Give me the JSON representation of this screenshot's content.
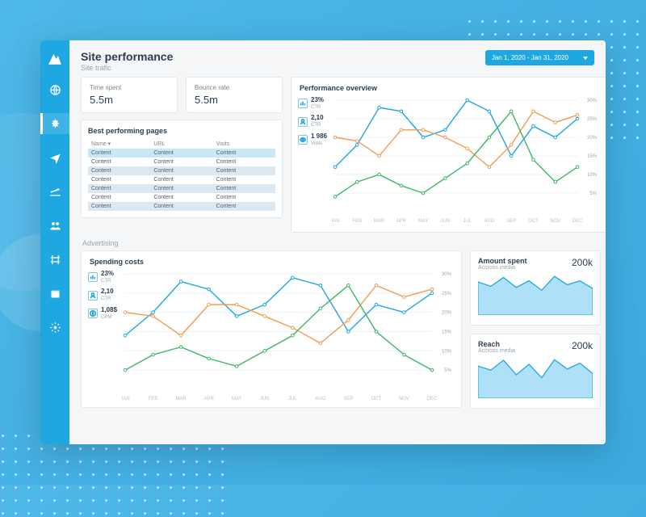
{
  "header": {
    "title": "Site performance",
    "subtitle": "Site trafic",
    "date_range": "Jan 1, 2020 - Jan 31, 2020"
  },
  "kpi": {
    "time_spent_label": "Time spent",
    "time_spent": "5.5m",
    "bounce_label": "Bounce rate",
    "bounce": "5.5m"
  },
  "table": {
    "title": "Best performing pages",
    "cols": {
      "c0": "Name ▾",
      "c1": "URL",
      "c2": "Visits"
    },
    "cell": "Content"
  },
  "overview": {
    "title": "Performance overview",
    "stats": {
      "s0v": "23%",
      "s0l": "CTR",
      "s1v": "2,10",
      "s1l": "CTR",
      "s2v": "1 986",
      "s2l": "Visits"
    }
  },
  "advertising_label": "Advertising",
  "spending": {
    "title": "Spending costs",
    "stats": {
      "s0v": "23%",
      "s0l": "CTR",
      "s1v": "2,10",
      "s1l": "CTR",
      "s2v": "1,08$",
      "s2l": "CPM"
    }
  },
  "amount": {
    "title": "Amount spent",
    "sub": "Accross media",
    "value": "200k"
  },
  "reach": {
    "title": "Reach",
    "sub": "Accross media",
    "value": "200k"
  },
  "chart_data": [
    {
      "type": "line",
      "title": "Performance overview",
      "xlabel": "",
      "ylabel": "",
      "ylim": [
        0,
        30
      ],
      "categories": [
        "JAN",
        "FEB",
        "MAR",
        "APR",
        "MAY",
        "JUN",
        "JUL",
        "AUG",
        "SEP",
        "OCT",
        "NOV",
        "DEC"
      ],
      "series": [
        {
          "name": "blue",
          "values": [
            12,
            18,
            28,
            27,
            20,
            22,
            30,
            27,
            15,
            23,
            20,
            25
          ]
        },
        {
          "name": "orange",
          "values": [
            20,
            19,
            15,
            22,
            22,
            20,
            17,
            12,
            18,
            27,
            24,
            26
          ]
        },
        {
          "name": "green",
          "values": [
            4,
            8,
            10,
            7,
            5,
            9,
            13,
            20,
            27,
            14,
            8,
            12
          ]
        }
      ]
    },
    {
      "type": "line",
      "title": "Spending costs",
      "xlabel": "",
      "ylabel": "",
      "ylim": [
        0,
        30
      ],
      "categories": [
        "JAN",
        "FEB",
        "MAR",
        "APR",
        "MAY",
        "JUN",
        "JUL",
        "AUG",
        "SEP",
        "OCT",
        "NOV",
        "DEC"
      ],
      "series": [
        {
          "name": "blue",
          "values": [
            14,
            20,
            28,
            26,
            19,
            22,
            29,
            27,
            15,
            22,
            20,
            25
          ]
        },
        {
          "name": "orange",
          "values": [
            20,
            19,
            14,
            22,
            22,
            19,
            16,
            12,
            18,
            27,
            24,
            26
          ]
        },
        {
          "name": "green",
          "values": [
            5,
            9,
            11,
            8,
            6,
            10,
            14,
            21,
            27,
            15,
            9,
            5
          ]
        }
      ]
    },
    {
      "type": "area",
      "title": "Amount spent",
      "categories": [
        0,
        1,
        2,
        3,
        4,
        5,
        6,
        7,
        8,
        9
      ],
      "values": [
        60,
        52,
        68,
        50,
        62,
        45,
        70,
        55,
        62,
        48
      ]
    },
    {
      "type": "area",
      "title": "Reach",
      "categories": [
        0,
        1,
        2,
        3,
        4,
        5,
        6,
        7,
        8,
        9
      ],
      "values": [
        55,
        48,
        65,
        40,
        58,
        35,
        66,
        50,
        60,
        42
      ]
    }
  ]
}
